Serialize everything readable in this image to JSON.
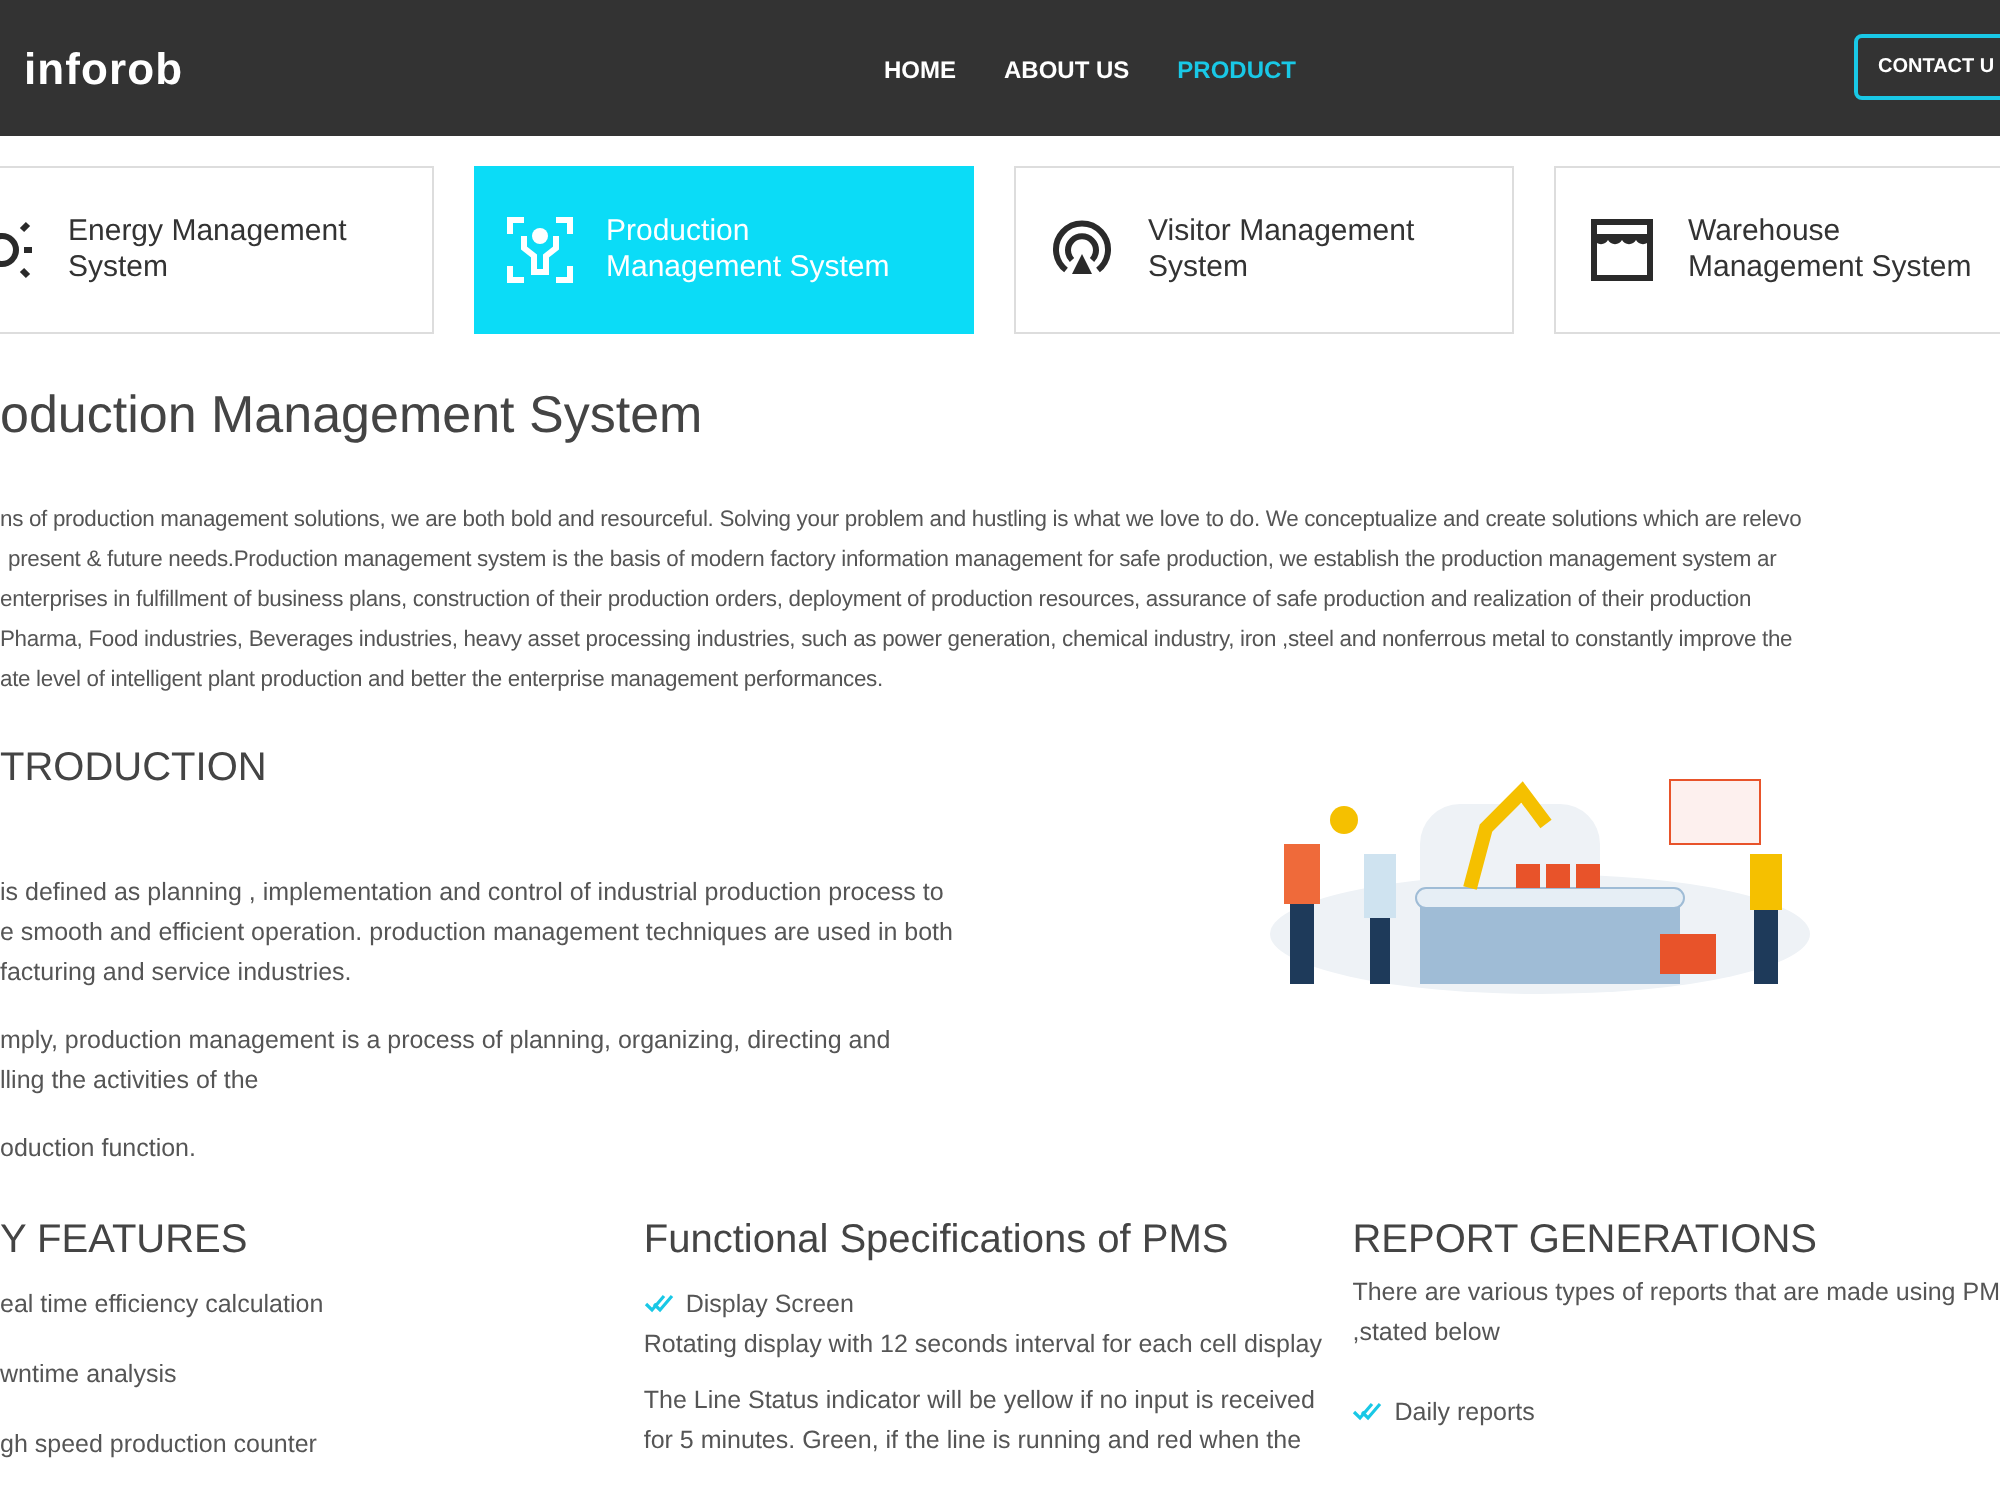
{
  "header": {
    "logo": "inforob",
    "nav": [
      {
        "label": "HOME",
        "selected": false
      },
      {
        "label": "ABOUT US",
        "selected": false
      },
      {
        "label": "PRODUCT",
        "selected": true
      }
    ],
    "contact_button": "CONTACT U"
  },
  "product_tabs": [
    {
      "label": "Energy Management System",
      "kind": "sun",
      "selected": false
    },
    {
      "label": "Production Management System",
      "kind": "worker",
      "selected": true
    },
    {
      "label": "Visitor Management System",
      "kind": "location",
      "selected": false
    },
    {
      "label": "Warehouse Management System",
      "kind": "store",
      "selected": false
    }
  ],
  "title": "oduction Management System",
  "description_lines": [
    "ns of production management solutions, we are both bold and resourceful. Solving your problem and hustling is what we love to do. We conceptualize and create solutions which are relevo",
    "present & future needs.Production management system is the basis of modern factory information management for safe production, we establish the production management system ar",
    "enterprises in fulfillment of business plans, construction of their production orders, deployment of production resources, assurance of safe production and realization of their production",
    "Pharma, Food industries, Beverages industries, heavy asset processing industries, such as power generation, chemical industry, iron ,steel and nonferrous metal to constantly improve the",
    "ate level of intelligent plant production and better the enterprise management performances."
  ],
  "introduction": {
    "heading": "TRODUCTION",
    "paragraphs": [
      [
        "is defined as planning , implementation and control of industrial production process to",
        "e smooth and efficient operation. production management techniques are used in both",
        "facturing and service industries."
      ],
      [
        "mply, production management is a process of planning, organizing, directing and",
        "lling the activities of the"
      ],
      [
        "oduction function."
      ]
    ]
  },
  "features": {
    "heading": "Y FEATURES",
    "items": [
      "eal time efficiency calculation",
      "wntime analysis",
      "gh speed production counter"
    ]
  },
  "functional_specs": {
    "heading": "Functional Specifications of PMS",
    "items": [
      {
        "title": "Display Screen",
        "text": "Rotating display with 12 seconds interval for each cell display"
      }
    ],
    "paragraph": [
      "The Line Status indicator will be yellow if no input is received",
      "for 5 minutes. Green, if the line is running and red when the"
    ]
  },
  "reports": {
    "heading": "REPORT GENERATIONS",
    "intro": [
      "There are various types of reports that are made using PM",
      ",stated below"
    ],
    "items": [
      "Daily reports"
    ]
  }
}
